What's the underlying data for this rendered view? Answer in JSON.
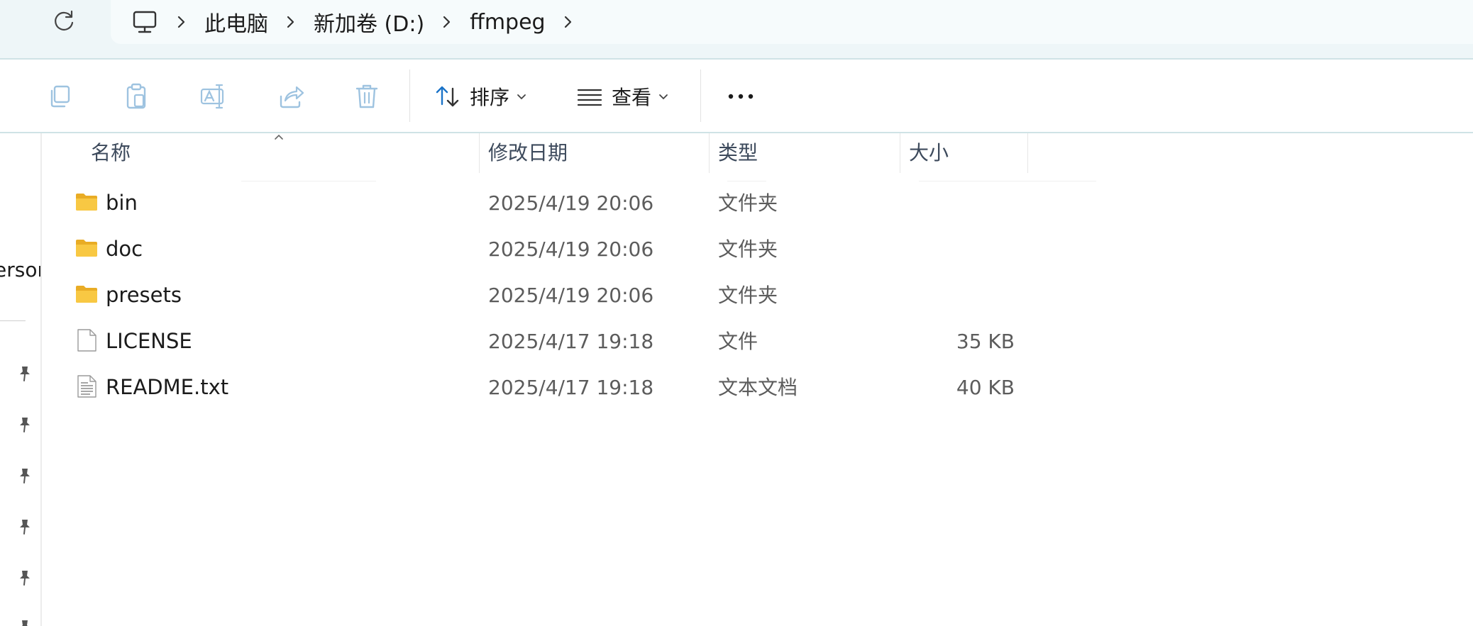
{
  "address": {
    "breadcrumbs": [
      "此电脑",
      "新加卷 (D:)",
      "ffmpeg"
    ]
  },
  "toolbar": {
    "sort_label": "排序",
    "view_label": "查看"
  },
  "nav": {
    "partial_label": "ersor"
  },
  "columns": {
    "name": "名称",
    "modified": "修改日期",
    "type": "类型",
    "size": "大小"
  },
  "files": [
    {
      "name": "bin",
      "modified": "2025/4/19 20:06",
      "type": "文件夹",
      "size": "",
      "icon": "folder-icon"
    },
    {
      "name": "doc",
      "modified": "2025/4/19 20:06",
      "type": "文件夹",
      "size": "",
      "icon": "folder-icon"
    },
    {
      "name": "presets",
      "modified": "2025/4/19 20:06",
      "type": "文件夹",
      "size": "",
      "icon": "folder-icon"
    },
    {
      "name": "LICENSE",
      "modified": "2025/4/17 19:18",
      "type": "文件",
      "size": "35 KB",
      "icon": "file-icon"
    },
    {
      "name": "README.txt",
      "modified": "2025/4/17 19:18",
      "type": "文本文档",
      "size": "40 KB",
      "icon": "text-file-icon"
    }
  ],
  "colors": {
    "accent": "#1a73c8",
    "folder": "#f6c342",
    "disabled_icon": "#9ec3e0"
  }
}
